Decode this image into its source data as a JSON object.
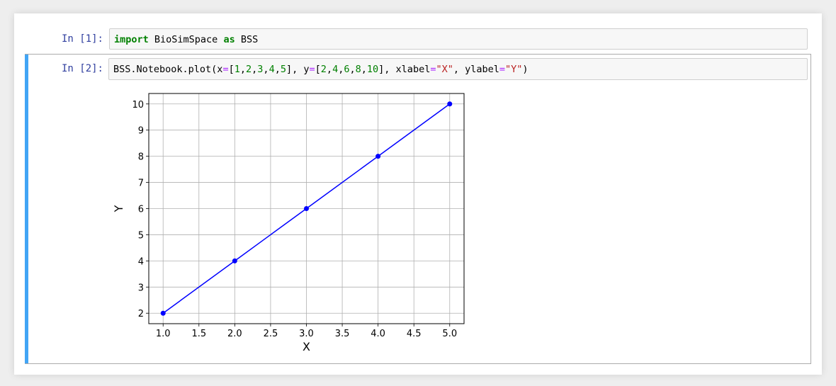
{
  "cells": [
    {
      "prompt": "In [1]:",
      "code": [
        {
          "t": "import",
          "c": "kw"
        },
        {
          "t": " BioSimSpace ",
          "c": ""
        },
        {
          "t": "as",
          "c": "kw"
        },
        {
          "t": " BSS",
          "c": ""
        }
      ]
    },
    {
      "prompt": "In [2]:",
      "code": [
        {
          "t": "BSS.Notebook.plot(x",
          "c": ""
        },
        {
          "t": "=",
          "c": "op"
        },
        {
          "t": "[",
          "c": ""
        },
        {
          "t": "1",
          "c": "num"
        },
        {
          "t": ",",
          "c": ""
        },
        {
          "t": "2",
          "c": "num"
        },
        {
          "t": ",",
          "c": ""
        },
        {
          "t": "3",
          "c": "num"
        },
        {
          "t": ",",
          "c": ""
        },
        {
          "t": "4",
          "c": "num"
        },
        {
          "t": ",",
          "c": ""
        },
        {
          "t": "5",
          "c": "num"
        },
        {
          "t": "], y",
          "c": ""
        },
        {
          "t": "=",
          "c": "op"
        },
        {
          "t": "[",
          "c": ""
        },
        {
          "t": "2",
          "c": "num"
        },
        {
          "t": ",",
          "c": ""
        },
        {
          "t": "4",
          "c": "num"
        },
        {
          "t": ",",
          "c": ""
        },
        {
          "t": "6",
          "c": "num"
        },
        {
          "t": ",",
          "c": ""
        },
        {
          "t": "8",
          "c": "num"
        },
        {
          "t": ",",
          "c": ""
        },
        {
          "t": "10",
          "c": "num"
        },
        {
          "t": "], xlabel",
          "c": ""
        },
        {
          "t": "=",
          "c": "op"
        },
        {
          "t": "\"X\"",
          "c": "str"
        },
        {
          "t": ", ylabel",
          "c": ""
        },
        {
          "t": "=",
          "c": "op"
        },
        {
          "t": "\"Y\"",
          "c": "str"
        },
        {
          "t": ")",
          "c": ""
        }
      ]
    }
  ],
  "colors": {
    "selected_bar": "#42a5f5",
    "prompt": "#303f9f",
    "series": "#0000ff"
  },
  "chart_data": {
    "type": "line",
    "x": [
      1,
      2,
      3,
      4,
      5
    ],
    "series": [
      {
        "values": [
          2,
          4,
          6,
          8,
          10
        ],
        "marker": "circle"
      }
    ],
    "xlabel": "X",
    "ylabel": "Y",
    "xlim": [
      0.8,
      5.2
    ],
    "ylim": [
      1.6,
      10.4
    ],
    "xticks": [
      "1.0",
      "1.5",
      "2.0",
      "2.5",
      "3.0",
      "3.5",
      "4.0",
      "4.5",
      "5.0"
    ],
    "yticks": [
      "2",
      "3",
      "4",
      "5",
      "6",
      "7",
      "8",
      "9",
      "10"
    ],
    "grid": true
  }
}
